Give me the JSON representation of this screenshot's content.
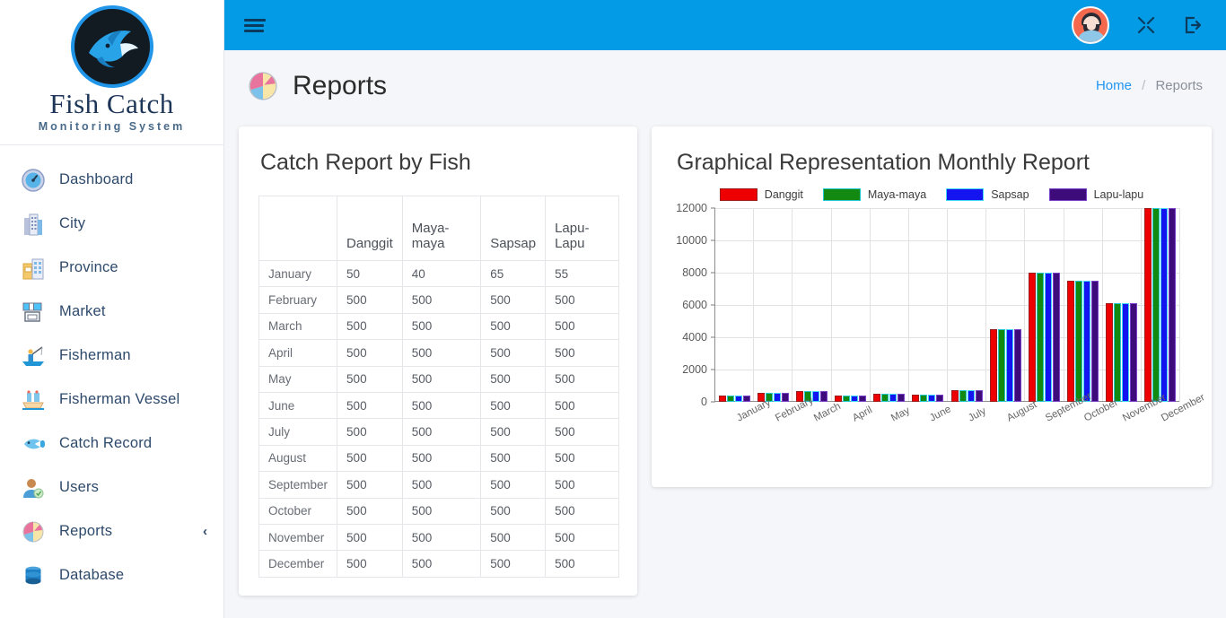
{
  "brand": {
    "name": "Fish Catch",
    "subtitle": "Monitoring System",
    "logo_icon": "shark-logo-icon"
  },
  "sidebar": {
    "items": [
      {
        "label": "Dashboard",
        "icon": "gauge-icon"
      },
      {
        "label": "City",
        "icon": "city-buildings-icon"
      },
      {
        "label": "Province",
        "icon": "government-building-icon"
      },
      {
        "label": "Market",
        "icon": "market-stall-icon"
      },
      {
        "label": "Fisherman",
        "icon": "fisherman-icon"
      },
      {
        "label": "Fisherman Vessel",
        "icon": "boat-icon"
      },
      {
        "label": "Catch Record",
        "icon": "fish-icon"
      },
      {
        "label": "Users",
        "icon": "user-icon"
      },
      {
        "label": "Reports",
        "icon": "pie-chart-icon",
        "caret": "‹"
      },
      {
        "label": "Database",
        "icon": "database-icon"
      }
    ]
  },
  "topbar": {
    "menu_icon": "hamburger-menu-icon",
    "avatar_icon": "user-avatar-icon",
    "fullscreen_icon": "expand-arrows-icon",
    "logout_icon": "logout-icon",
    "bg_color": "#039be5"
  },
  "page": {
    "title": "Reports",
    "title_icon": "pie-chart-icon",
    "breadcrumb": {
      "home": "Home",
      "separator": "/",
      "current": "Reports"
    }
  },
  "table_card": {
    "title": "Catch Report by Fish",
    "columns": [
      "",
      "Danggit",
      "Maya-maya",
      "Sapsap",
      "Lapu-Lapu"
    ],
    "rows": [
      {
        "month": "January",
        "values": [
          "50",
          "40",
          "65",
          "55"
        ]
      },
      {
        "month": "February",
        "values": [
          "500",
          "500",
          "500",
          "500"
        ]
      },
      {
        "month": "March",
        "values": [
          "500",
          "500",
          "500",
          "500"
        ]
      },
      {
        "month": "April",
        "values": [
          "500",
          "500",
          "500",
          "500"
        ]
      },
      {
        "month": "May",
        "values": [
          "500",
          "500",
          "500",
          "500"
        ]
      },
      {
        "month": "June",
        "values": [
          "500",
          "500",
          "500",
          "500"
        ]
      },
      {
        "month": "July",
        "values": [
          "500",
          "500",
          "500",
          "500"
        ]
      },
      {
        "month": "August",
        "values": [
          "500",
          "500",
          "500",
          "500"
        ]
      },
      {
        "month": "September",
        "values": [
          "500",
          "500",
          "500",
          "500"
        ]
      },
      {
        "month": "October",
        "values": [
          "500",
          "500",
          "500",
          "500"
        ]
      },
      {
        "month": "November",
        "values": [
          "500",
          "500",
          "500",
          "500"
        ]
      },
      {
        "month": "December",
        "values": [
          "500",
          "500",
          "500",
          "500"
        ]
      }
    ]
  },
  "chart_card": {
    "title": "Graphical Representation Monthly Report"
  },
  "chart_data": {
    "type": "bar",
    "title": "Graphical Representation Monthly Report",
    "xlabel": "",
    "ylabel": "",
    "ylim": [
      0,
      12000
    ],
    "yticks": [
      0,
      2000,
      4000,
      6000,
      8000,
      10000,
      12000
    ],
    "grid": true,
    "legend_position": "top-center",
    "categories": [
      "January",
      "February",
      "March",
      "April",
      "May",
      "June",
      "July",
      "August",
      "September",
      "October",
      "November",
      "December"
    ],
    "series": [
      {
        "name": "Danggit",
        "color": "#ee0000",
        "border": "#9b1d1d",
        "values": [
          400,
          560,
          640,
          380,
          520,
          450,
          700,
          4500,
          8000,
          7500,
          6100,
          12000
        ]
      },
      {
        "name": "Maya-maya",
        "color": "#128a12",
        "border": "#25c7cf",
        "values": [
          400,
          560,
          640,
          380,
          520,
          450,
          700,
          4500,
          8000,
          7500,
          6100,
          12000
        ]
      },
      {
        "name": "Sapsap",
        "color": "#1414f0",
        "border": "#41d6f5",
        "values": [
          400,
          560,
          640,
          380,
          520,
          450,
          700,
          4500,
          8000,
          7500,
          6100,
          12000
        ]
      },
      {
        "name": "Lapu-lapu",
        "color": "#3d0b7a",
        "border": "#7a42c9",
        "values": [
          400,
          560,
          640,
          380,
          520,
          450,
          700,
          4500,
          8000,
          7500,
          6100,
          12000
        ]
      }
    ]
  }
}
